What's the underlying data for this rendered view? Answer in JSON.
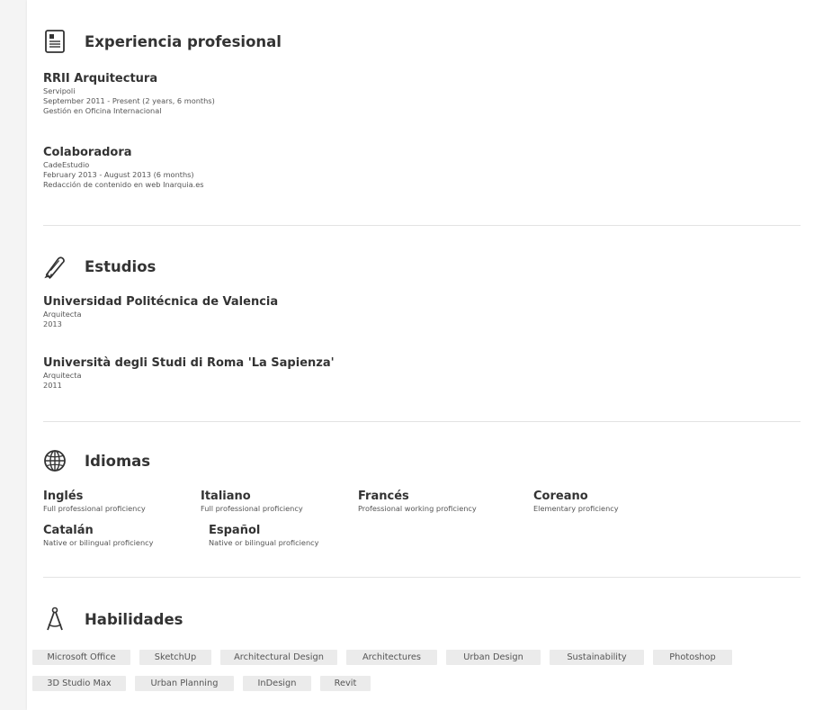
{
  "experience": {
    "title": "Experiencia profesional",
    "icon": "resume-document-icon",
    "items": [
      {
        "title": "RRII Arquitectura",
        "company": "Servipoli",
        "dates": "September 2011 - Present (2 years, 6 months)",
        "description": "Gestión en Oficina Internacional"
      },
      {
        "title": "Colaboradora",
        "company": "CadeEstudio",
        "dates": "February 2013 - August 2013 (6 months)",
        "description": "Redacción de contenido en web Inarquia.es"
      }
    ]
  },
  "education": {
    "title": "Estudios",
    "icon": "diploma-scroll-icon",
    "items": [
      {
        "school": "Universidad Politécnica de Valencia",
        "degree": "Arquitecta",
        "year": "2013"
      },
      {
        "school": "Università degli Studi di Roma 'La Sapienza'",
        "degree": "Arquitecta",
        "year": "2011"
      }
    ]
  },
  "languages": {
    "title": "Idiomas",
    "icon": "globe-icon",
    "items": [
      {
        "name": "Inglés",
        "level": "Full professional proficiency"
      },
      {
        "name": "Italiano",
        "level": "Full professional proficiency"
      },
      {
        "name": "Francés",
        "level": "Professional working proficiency"
      },
      {
        "name": "Coreano",
        "level": "Elementary proficiency"
      },
      {
        "name": "Catalán",
        "level": "Native or bilingual proficiency"
      },
      {
        "name": "Español",
        "level": "Native or bilingual proficiency"
      }
    ]
  },
  "skills": {
    "title": "Habilidades",
    "icon": "drafting-compass-icon",
    "items": [
      "Microsoft Office",
      "SketchUp",
      "Architectural Design",
      "Architectures",
      "Urban Design",
      "Sustainability",
      "Photoshop",
      "3D Studio Max",
      "Urban Planning",
      "InDesign",
      "Revit"
    ]
  },
  "colors": {
    "text": "#333333",
    "muted": "#555555",
    "divider": "#e3e3e3",
    "tag_background": "#ebebeb"
  }
}
